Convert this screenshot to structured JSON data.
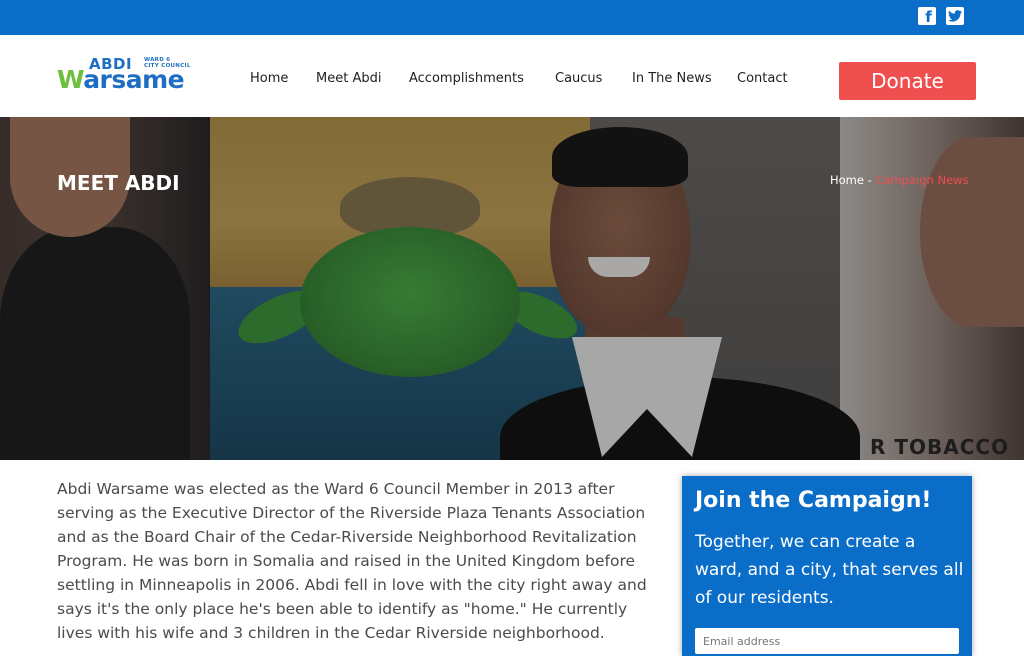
{
  "topbar": {
    "social": [
      {
        "icon": "facebook-icon",
        "glyph": "f"
      },
      {
        "icon": "twitter-icon",
        "glyph": "🐦"
      }
    ]
  },
  "header": {
    "logo": {
      "abdi": "ABDI",
      "warsame_w": "W",
      "warsame_rest": "arsame",
      "ward_line1": "WARD 6",
      "ward_line2": "CITY COUNCIL"
    },
    "nav": [
      {
        "label": "Home"
      },
      {
        "label": "Meet Abdi"
      },
      {
        "label": "Accomplishments"
      },
      {
        "label": "Caucus"
      },
      {
        "label": "In The News"
      },
      {
        "label": "Contact"
      }
    ],
    "donate_label": "Donate"
  },
  "hero": {
    "title": "MEET ABDI",
    "breadcrumb": {
      "home": "Home",
      "separator": " - ",
      "current": "Campaign News"
    },
    "mural_text": "R TOBACCO"
  },
  "content": {
    "paragraph": "Abdi Warsame was elected as the Ward 6 Council Member in 2013 after serving as the Executive Director of the Riverside Plaza Tenants Association and as the Board Chair of the Cedar-Riverside Neighborhood Revitalization Program. He was born in Somalia and raised in the United Kingdom before settling in Minneapolis in 2006. Abdi fell in love with the city right away and says it's the only place he's been able to identify as \"home.\" He currently lives with his wife and 3 children in the Cedar Riverside neighborhood."
  },
  "sidebar": {
    "title": "Join the Campaign!",
    "text": "Together, we can create a ward, and a city, that serves all of our residents.",
    "email_placeholder": "Email address"
  },
  "colors": {
    "brand_blue": "#0a6ec9",
    "donate_red": "#ef4f4f",
    "logo_green": "#6cbf3f"
  }
}
